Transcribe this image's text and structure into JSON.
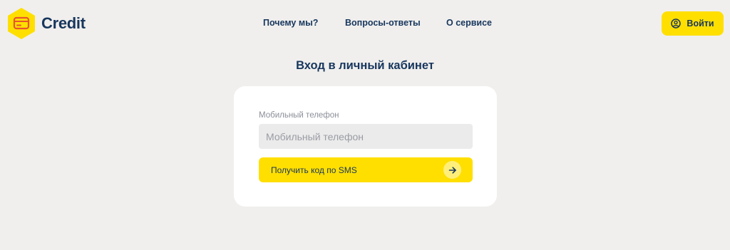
{
  "header": {
    "logo_text": "Credit",
    "nav": [
      {
        "label": "Почему мы?"
      },
      {
        "label": "Вопросы-ответы"
      },
      {
        "label": "О сервисе"
      }
    ],
    "login_label": "Войти"
  },
  "main": {
    "title": "Вход в личный кабинет",
    "phone": {
      "label": "Мобильный телефон",
      "placeholder": "Мобильный телефон",
      "value": ""
    },
    "sms_button_label": "Получить код по SMS"
  },
  "icons": {
    "logo": "card-hexagon-icon",
    "login": "user-circle-icon",
    "submit": "arrow-right-icon"
  },
  "colors": {
    "brand_yellow": "#ffdf00",
    "brand_navy": "#17365d",
    "background": "#f0efed",
    "card": "#ffffff",
    "input_bg": "#ebebeb",
    "logo_accent": "#e8552d"
  }
}
